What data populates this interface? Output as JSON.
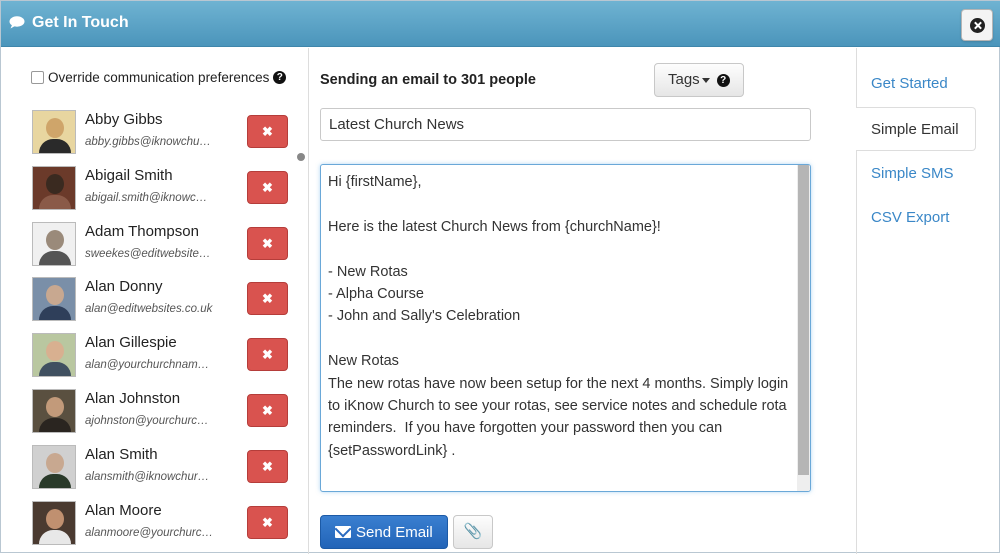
{
  "header": {
    "title": "Get In Touch"
  },
  "override": {
    "label": "Override communication preferences"
  },
  "contacts": [
    {
      "name": "Abby Gibbs",
      "email": "abby.gibbs@iknowchu…",
      "colors": [
        "#e8d6a0",
        "#cfa56a",
        "#2a2a2a"
      ]
    },
    {
      "name": "Abigail Smith",
      "email": "abigail.smith@iknowc…",
      "colors": [
        "#6b3a2a",
        "#3a2a20",
        "#8a5a48"
      ]
    },
    {
      "name": "Adam Thompson",
      "email": "sweekes@editwebsite…",
      "colors": [
        "#f0f0f0",
        "#9a8a7a",
        "#555555"
      ]
    },
    {
      "name": "Alan Donny",
      "email": "alan@editwebsites.co.uk",
      "colors": [
        "#7a8fa8",
        "#c8a890",
        "#2f3f5a"
      ]
    },
    {
      "name": "Alan Gillespie",
      "email": "alan@yourchurchnam…",
      "colors": [
        "#b9c7a0",
        "#d8b090",
        "#405060"
      ]
    },
    {
      "name": "Alan Johnston",
      "email": "ajohnston@yourchurc…",
      "colors": [
        "#5a5040",
        "#c29a7a",
        "#2a2520"
      ]
    },
    {
      "name": "Alan Smith",
      "email": "alansmith@iknowchur…",
      "colors": [
        "#d0d0d0",
        "#c8a890",
        "#2a3a2a"
      ]
    },
    {
      "name": "Alan Moore",
      "email": "alanmoore@yourchurc…",
      "colors": [
        "#4a3a30",
        "#c09070",
        "#e8e8e8"
      ]
    }
  ],
  "compose": {
    "heading": "Sending an email to 301 people",
    "tags_label": "Tags",
    "subject": "Latest Church News",
    "body": "Hi {firstName},\n\nHere is the latest Church News from {churchName}!\n\n- New Rotas\n- Alpha Course\n- John and Sally's Celebration\n\nNew Rotas\nThe new rotas have now been setup for the next 4 months. Simply login to iKnow Church to see your rotas, see service notes and schedule rota reminders.  If you have forgotten your password then you can {setPasswordLink} .",
    "send_label": "Send Email",
    "attach_icon": "📎"
  },
  "tabs": [
    {
      "label": "Get Started",
      "active": false
    },
    {
      "label": "Simple Email",
      "active": true
    },
    {
      "label": "Simple SMS",
      "active": false
    },
    {
      "label": "CSV Export",
      "active": false
    }
  ],
  "icons": {
    "remove": "✖",
    "help": "?"
  },
  "colors": {
    "header": "#4b95bb",
    "danger": "#d9534f",
    "primary": "#2264b8",
    "link": "#3a87c7"
  }
}
